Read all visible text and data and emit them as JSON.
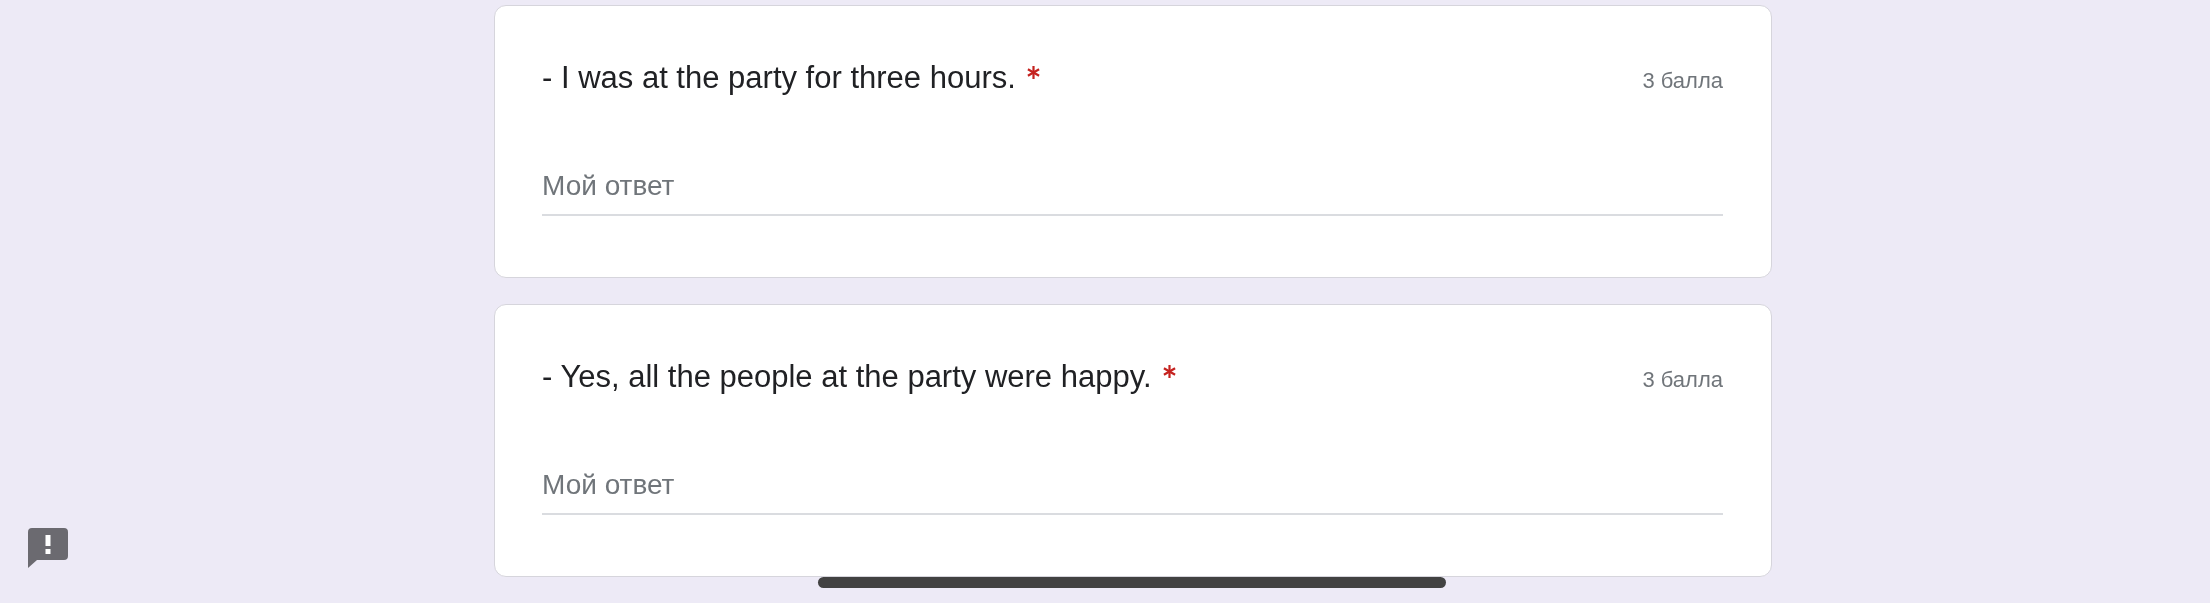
{
  "questions": [
    {
      "title": "- I was at the party for three hours.",
      "required": true,
      "points": "3 балла",
      "answer": {
        "placeholder": "Мой ответ"
      }
    },
    {
      "title": "- Yes, all the people at the party were happy.",
      "required": true,
      "points": "3 балла",
      "answer": {
        "placeholder": "Мой ответ"
      }
    }
  ]
}
